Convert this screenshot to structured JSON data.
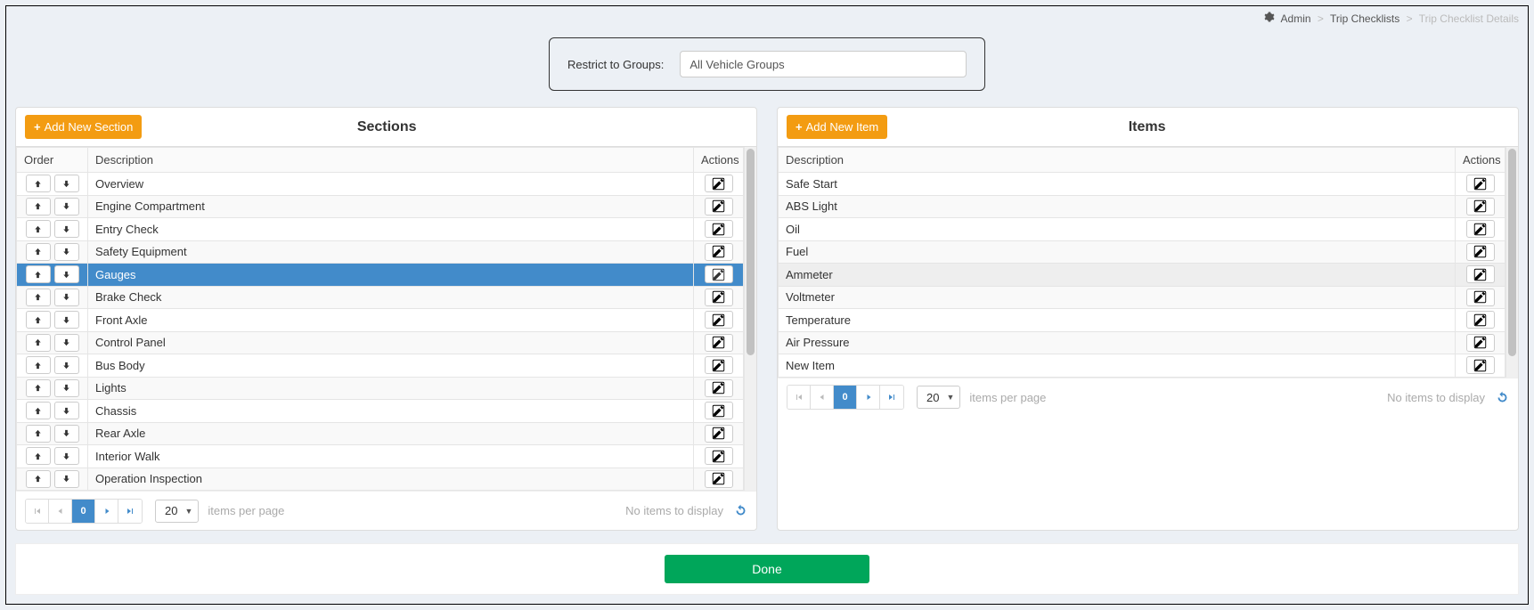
{
  "breadcrumb": {
    "admin": "Admin",
    "level1": "Trip Checklists",
    "current": "Trip Checklist Details"
  },
  "restrict": {
    "label": "Restrict to Groups:",
    "value": "All Vehicle Groups"
  },
  "sections_panel": {
    "add_label": "Add New Section",
    "title": "Sections",
    "col_order": "Order",
    "col_desc": "Description",
    "col_actions": "Actions",
    "rows": [
      {
        "desc": "Overview",
        "selected": false
      },
      {
        "desc": "Engine Compartment",
        "selected": false
      },
      {
        "desc": "Entry Check",
        "selected": false
      },
      {
        "desc": "Safety Equipment",
        "selected": false
      },
      {
        "desc": "Gauges",
        "selected": true
      },
      {
        "desc": "Brake Check",
        "selected": false
      },
      {
        "desc": "Front Axle",
        "selected": false
      },
      {
        "desc": "Control Panel",
        "selected": false
      },
      {
        "desc": "Bus Body",
        "selected": false
      },
      {
        "desc": "Lights",
        "selected": false
      },
      {
        "desc": "Chassis",
        "selected": false
      },
      {
        "desc": "Rear Axle",
        "selected": false
      },
      {
        "desc": "Interior Walk",
        "selected": false
      },
      {
        "desc": "Operation Inspection",
        "selected": false
      }
    ],
    "pager": {
      "page": "0",
      "size": "20",
      "per_page_label": "items per page",
      "status": "No items to display"
    }
  },
  "items_panel": {
    "add_label": "Add New Item",
    "title": "Items",
    "col_desc": "Description",
    "col_actions": "Actions",
    "rows": [
      {
        "desc": "Safe Start",
        "hover": false
      },
      {
        "desc": "ABS Light",
        "hover": false
      },
      {
        "desc": "Oil",
        "hover": false
      },
      {
        "desc": "Fuel",
        "hover": false
      },
      {
        "desc": "Ammeter",
        "hover": true
      },
      {
        "desc": "Voltmeter",
        "hover": false
      },
      {
        "desc": "Temperature",
        "hover": false
      },
      {
        "desc": "Air Pressure",
        "hover": false
      },
      {
        "desc": "New Item",
        "hover": false
      }
    ],
    "pager": {
      "page": "0",
      "size": "20",
      "per_page_label": "items per page",
      "status": "No items to display"
    }
  },
  "footer": {
    "done": "Done"
  }
}
